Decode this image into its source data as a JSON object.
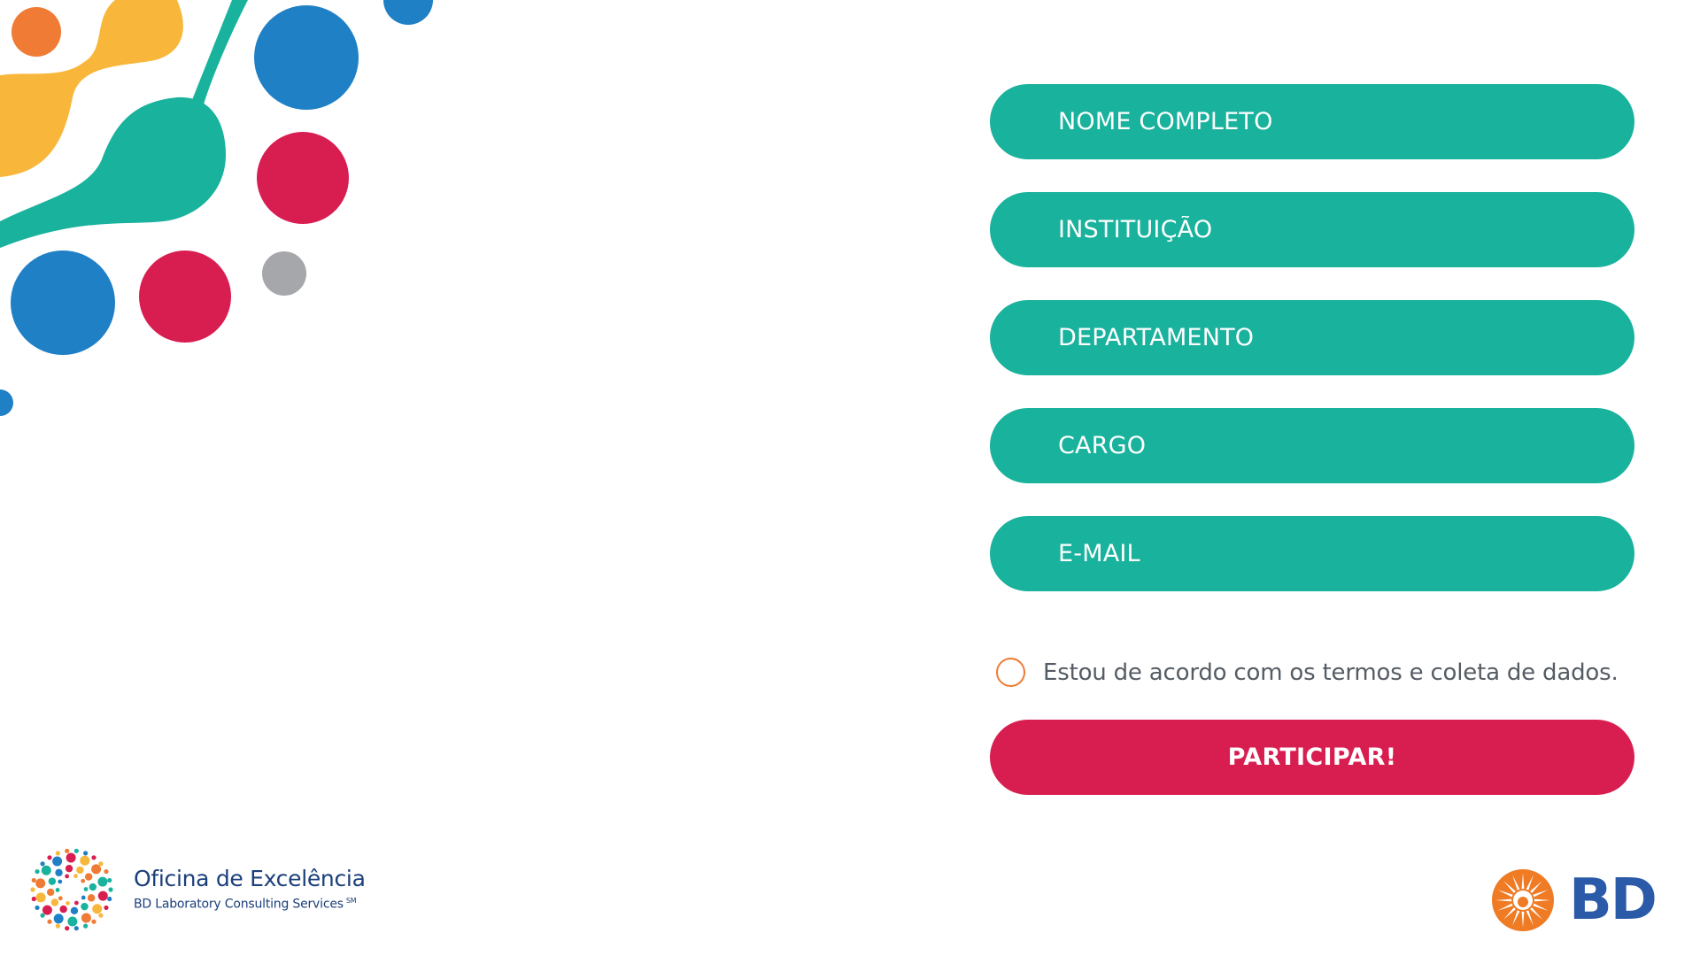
{
  "colors": {
    "field_teal": "#19b29d",
    "submit_crimson": "#d81e50",
    "radio_orange": "#ef7b34",
    "brand_navy": "#1b3f7a",
    "bd_blue": "#2b5aa8",
    "bd_orange": "#ef7b24",
    "decor_blue": "#1f80c6",
    "decor_red": "#d81e50",
    "decor_yellow": "#f8b73b",
    "decor_orange": "#ef7b34",
    "decor_teal": "#19b29d",
    "decor_gray": "#a5a7aa"
  },
  "form": {
    "fields": [
      {
        "placeholder": "NOME COMPLETO"
      },
      {
        "placeholder": "INSTITUIÇÃO"
      },
      {
        "placeholder": "DEPARTAMENTO"
      },
      {
        "placeholder": "CARGO"
      },
      {
        "placeholder": "E-MAIL"
      }
    ],
    "consent_label": "Estou de acordo com os termos e coleta de dados.",
    "submit_label": "PARTICIPAR!"
  },
  "brand_left": {
    "title": "Oficina de Excelência",
    "subtitle": "BD Laboratory Consulting Services",
    "mark": "SM",
    "icon": "oficina-flower-logo-icon"
  },
  "brand_right": {
    "text": "BD",
    "icon": "bd-sun-logo-icon"
  }
}
